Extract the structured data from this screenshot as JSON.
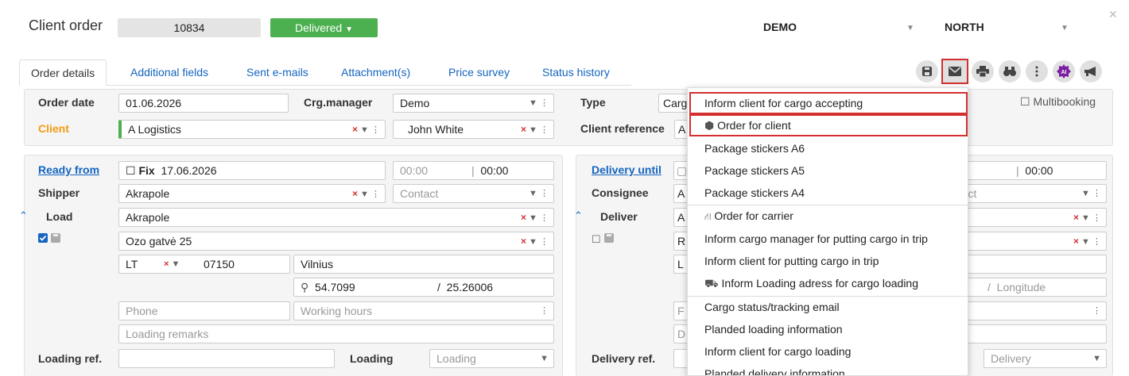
{
  "header": {
    "title": "Client order",
    "order_number": "10834",
    "status": "Delivered",
    "company": "DEMO",
    "region": "NORTH"
  },
  "tabs": [
    "Order details",
    "Additional fields",
    "Sent e-mails",
    "Attachment(s)",
    "Price survey",
    "Status history"
  ],
  "top": {
    "order_date_label": "Order date",
    "order_date": "01.06.2026",
    "crg_manager_label": "Crg.manager",
    "crg_manager": "Demo",
    "type_label": "Type",
    "type_value": "Carg",
    "multibooking_label": "Multibooking",
    "client_label": "Client",
    "client": "A Logistics",
    "contact": "John White",
    "client_ref_label": "Client reference",
    "client_ref": "A"
  },
  "loading": {
    "ready_from_label": "Ready from",
    "fix_label": "Fix",
    "date": "17.06.2026",
    "time_from": "00:00",
    "time_to": "00:00",
    "shipper_label": "Shipper",
    "shipper": "Akrapole",
    "contact_placeholder": "Contact",
    "load_label": "Load",
    "load": "Akrapole",
    "address": "Ozo gatvė 25",
    "country": "LT",
    "postcode": "07150",
    "city": "Vilnius",
    "lat": "54.7099",
    "lon": "25.26006",
    "phone_placeholder": "Phone",
    "hours_placeholder": "Working hours",
    "remarks_placeholder": "Loading remarks",
    "ref_label": "Loading ref.",
    "type_label": "Loading",
    "type_placeholder": "Loading"
  },
  "delivery": {
    "until_label": "Delivery until",
    "time_from": "00",
    "time_to": "00:00",
    "consignee_label": "Consignee",
    "consignee": "A",
    "contact_placeholder": "ntact",
    "deliver_label": "Deliver",
    "deliver": "A",
    "addr": "R",
    "city": "L",
    "lon_placeholder": "Longitude",
    "f_placeholder": "F",
    "d_placeholder": "D",
    "ref_label": "Delivery ref.",
    "type_placeholder": "Delivery"
  },
  "menu": {
    "items": [
      "Inform client for cargo accepting",
      "Order for client",
      "Package stickers A6",
      "Package stickers A5",
      "Package stickers A4",
      "Order for carrier",
      "Inform cargo manager for putting cargo in trip",
      "Inform client for putting cargo in trip",
      "Inform Loading adress for cargo loading",
      "Cargo status/tracking email",
      "Planded loading information",
      "Inform client for cargo loading",
      "Planded delivery information"
    ]
  },
  "colors": {
    "accent": "#1565c0",
    "status": "#4caf50",
    "highlight": "#d32f2f",
    "client_label": "#f39c12"
  }
}
